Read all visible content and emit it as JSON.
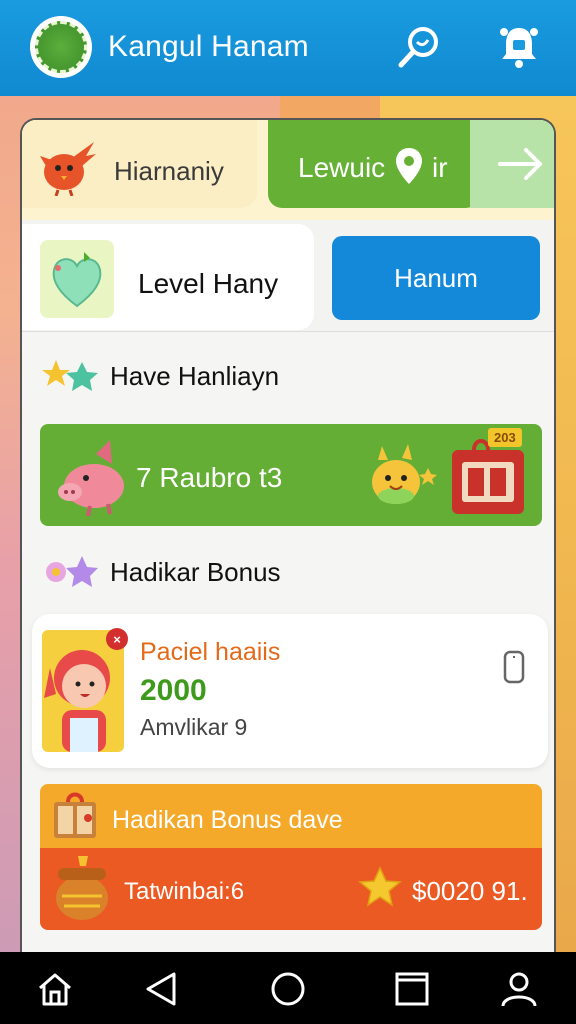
{
  "header": {
    "title": "Kangul Hanam",
    "icons": [
      "app-logo-icon",
      "search-icon",
      "bell-icon"
    ]
  },
  "tabs": {
    "left_label": "Hiarnaniy",
    "green_label": "Lewuic",
    "green_suffix": "ir"
  },
  "level": {
    "label": "Level Hany",
    "button_label": "Hanum"
  },
  "section1": {
    "title": "Have Hanliayn"
  },
  "promo": {
    "label": "7 Raubro t3",
    "badge": "203"
  },
  "section2": {
    "title": "Hadikar Bonus"
  },
  "reward_card": {
    "title": "Paciel haaiis",
    "amount": "2000",
    "subtitle": "Amvlikar 9"
  },
  "bonus": {
    "title": "Hadikan Bonus dave",
    "label": "Tatwinbai:6",
    "value": "$0020 91."
  },
  "colors": {
    "header": "#1a9be0",
    "green": "#64ae36",
    "blue_button": "#1489da",
    "orange": "#f5a92a",
    "red": "#ec5a24"
  }
}
